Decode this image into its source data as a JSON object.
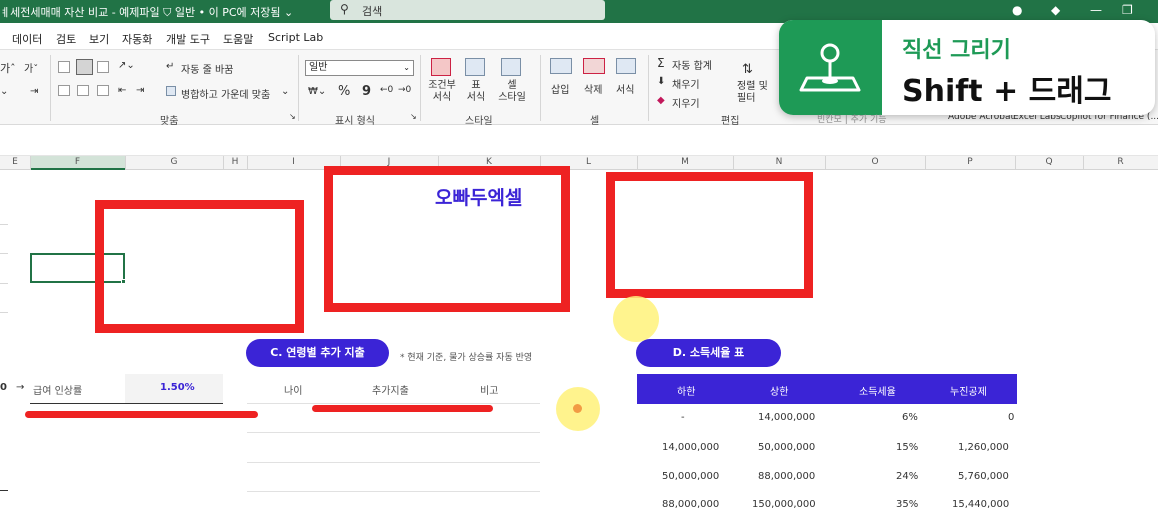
{
  "window": {
    "title": "ㅖ세전세매매 자산 비교 - 예제파일  ⛉ 일반 • 이 PC에 저장됨 ⌄",
    "search_placeholder": "검색"
  },
  "menu": [
    "데이터",
    "검토",
    "보기",
    "자동화",
    "개발 도구",
    "도움말",
    "Script Lab"
  ],
  "ribbon": {
    "font": {
      "grow": "가ˆ",
      "shrink": "가ˇ"
    },
    "alignment": {
      "wrap_text": "자동 줄 바꿈",
      "merge_center": "병합하고 가운데 맞춤",
      "group_label": "맞춤"
    },
    "number": {
      "format_value": "일반",
      "percent": "%",
      "comma": "9",
      "group_label": "표시 형식"
    },
    "styles": {
      "conditional": "조건부\n서식",
      "table": "표\n서식",
      "cell_style": "셀\n스타일",
      "group_label": "스타일"
    },
    "cells": {
      "insert": "삽입",
      "delete": "삭제",
      "format": "서식",
      "group_label": "셀"
    },
    "editing": {
      "autosum": "자동 합계",
      "fill": "채우기",
      "clear": "지우기",
      "sort_filter": "정렬 및\n필터",
      "group_label": "편집"
    },
    "addins": [
      "Adobe Acrobat",
      "Excel Labs",
      "Copilot for Finance (..."
    ]
  },
  "columns": [
    "E",
    "F",
    "G",
    "H",
    "I",
    "J",
    "K",
    "L",
    "M",
    "N",
    "O",
    "P",
    "Q",
    "R"
  ],
  "toast": {
    "title": "직선 그리기",
    "shortcut": "Shift + 드래그",
    "icon": "joystick-icon"
  },
  "sheet": {
    "brand": "오빠두엑셀",
    "salary_row": {
      "arrow": "→",
      "label": "급여 인상률",
      "value": "1.50%"
    },
    "section_c": {
      "title": "C. 연령별 추가 지출",
      "note": "* 현재 기준, 물가 상승률 자동 반영",
      "headers": [
        "나이",
        "추가지출",
        "비고"
      ]
    },
    "section_d": {
      "title": "D. 소득세율 표",
      "headers": [
        "하한",
        "상한",
        "소득세율",
        "누진공제"
      ],
      "rows": [
        [
          "-",
          "14,000,000",
          "6%",
          "0"
        ],
        [
          "14,000,000",
          "50,000,000",
          "15%",
          "1,260,000"
        ],
        [
          "50,000,000",
          "88,000,000",
          "24%",
          "5,760,000"
        ],
        [
          "88,000,000",
          "150,000,000",
          "35%",
          "15,440,000"
        ]
      ]
    }
  },
  "colors": {
    "excel_green": "#217346",
    "accent_purple": "#3b24d6",
    "annotation_red": "#ee2222",
    "cursor_yellow": "#fff27a"
  }
}
